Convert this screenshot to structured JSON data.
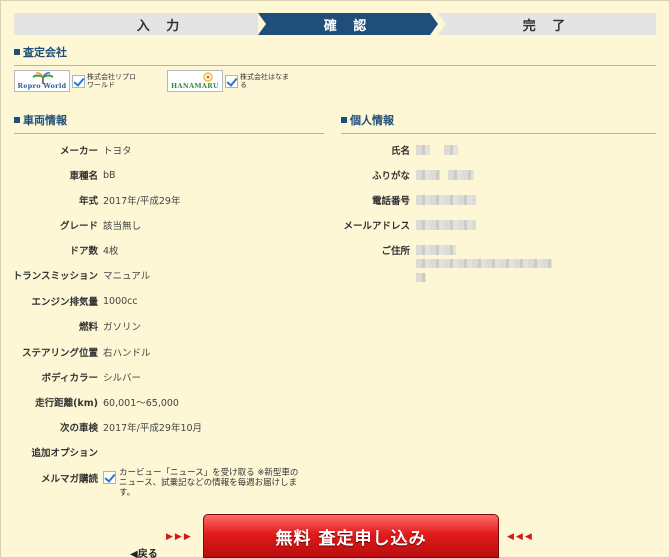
{
  "steps": [
    {
      "label": "入 力"
    },
    {
      "label": "確 認"
    },
    {
      "label": "完 了"
    }
  ],
  "sections": {
    "company": "査定会社",
    "vehicle": "車両情報",
    "personal": "個人情報"
  },
  "companies": [
    {
      "logo_text": "Repro World",
      "name": "株式会社リプロワールド",
      "checked": true
    },
    {
      "logo_text": "HANAMARU",
      "name": "株式会社はなまる",
      "checked": true
    }
  ],
  "vehicle": [
    {
      "label": "メーカー",
      "value": "トヨタ"
    },
    {
      "label": "車種名",
      "value": "bB"
    },
    {
      "label": "年式",
      "value": "2017年/平成29年"
    },
    {
      "label": "グレード",
      "value": "該当無し"
    },
    {
      "label": "ドア数",
      "value": "4枚"
    },
    {
      "label": "トランスミッション",
      "value": "マニュアル"
    },
    {
      "label": "エンジン排気量",
      "value": "1000cc"
    },
    {
      "label": "燃料",
      "value": "ガソリン"
    },
    {
      "label": "ステアリング位置",
      "value": "右ハンドル"
    },
    {
      "label": "ボディカラー",
      "value": "シルバー"
    },
    {
      "label": "走行距離(km)",
      "value": "60,001～65,000"
    },
    {
      "label": "次の車検",
      "value": "2017年/平成29年10月"
    },
    {
      "label": "追加オプション",
      "value": ""
    }
  ],
  "mail": {
    "label": "メルマガ購読",
    "text": "カービュー「ニュース」を受け取る ※新型車のニュース、試乗記などの情報を毎週お届けします。",
    "checked": true
  },
  "personal": [
    {
      "label": "氏名"
    },
    {
      "label": "ふりがな"
    },
    {
      "label": "電話番号"
    },
    {
      "label": "メールアドレス"
    },
    {
      "label": "ご住所"
    }
  ],
  "submit": {
    "label": "無料 査定申し込み",
    "arrows_left": "▶▶▶",
    "arrows_right": "◀◀◀"
  },
  "back": "◀戻る"
}
